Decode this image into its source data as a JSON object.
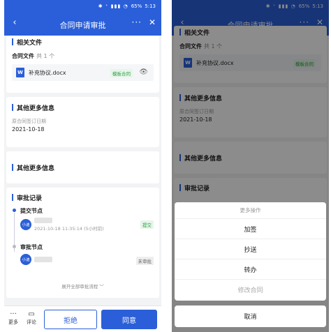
{
  "statusbar": {
    "icons": "✱ ⁺ ▮▮▮ ◔",
    "battery": "65%",
    "time": "5:13"
  },
  "navbar": {
    "back": "‹",
    "title": "合同申请审批",
    "more": "···",
    "close": "✕"
  },
  "files": {
    "section_title": "相关文件",
    "label": "合同文件",
    "count": "共 1 个",
    "file_icon_text": "W",
    "file_name": "补充协议.docx",
    "tag": "模板合同"
  },
  "other_info_1": {
    "title": "其他更多信息",
    "field_label": "原合同签订日期",
    "field_value": "2021-10-18"
  },
  "other_info_2": {
    "title": "其他更多信息"
  },
  "approval": {
    "title": "审批记录",
    "nodes": [
      {
        "title": "提交节点",
        "avatar": "小迪",
        "time": "2021-10-18 11:35:14 (5小时前)",
        "status": "提交"
      },
      {
        "title": "审批节点",
        "avatar": "小迪",
        "status": "未审批"
      }
    ],
    "expand_label": "展开全部审批流程 ﹀"
  },
  "bottom_bar": {
    "more_label": "更多",
    "comment_label": "评论",
    "reject_label": "拒绝",
    "approve_label": "同意"
  },
  "action_sheet": {
    "title": "更多操作",
    "items": [
      "加签",
      "抄送",
      "转办"
    ],
    "disabled_item": "修改合同",
    "cancel_label": "取消"
  },
  "colors": {
    "brand": "#2b5fd9",
    "green": "#2f9e44"
  }
}
